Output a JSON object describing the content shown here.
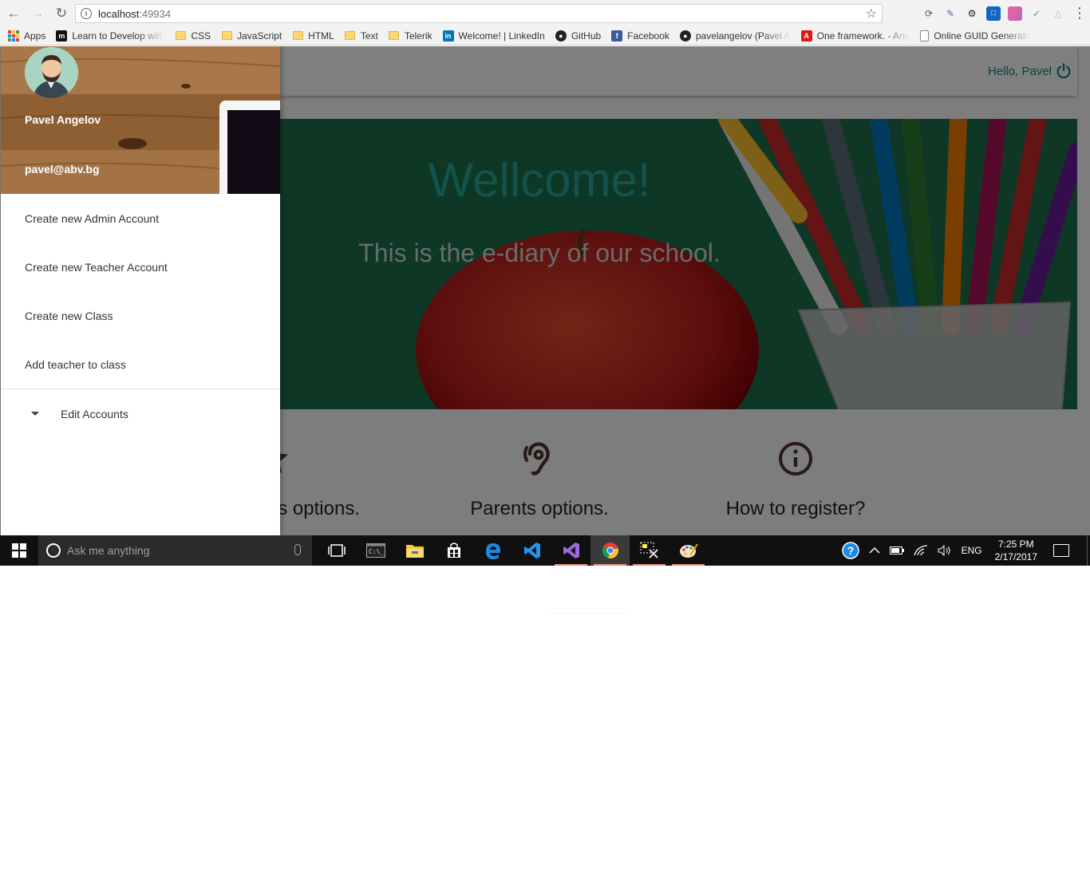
{
  "browser": {
    "url_host": "localhost",
    "url_port": ":49934"
  },
  "bookmarks": [
    {
      "label": "Apps",
      "icon": "apps-grid-icon"
    },
    {
      "label": "Learn to Develop with",
      "icon": "m-logo-icon"
    },
    {
      "label": "CSS",
      "icon": "folder-icon"
    },
    {
      "label": "JavaScript",
      "icon": "folder-icon"
    },
    {
      "label": "HTML",
      "icon": "folder-icon"
    },
    {
      "label": "Text",
      "icon": "folder-icon"
    },
    {
      "label": "Telerik",
      "icon": "folder-icon"
    },
    {
      "label": "Welcome! | LinkedIn",
      "icon": "linkedin-icon"
    },
    {
      "label": "GitHub",
      "icon": "github-icon"
    },
    {
      "label": "Facebook",
      "icon": "facebook-icon"
    },
    {
      "label": "pavelangelov (Pavel A",
      "icon": "github-icon"
    },
    {
      "label": "One framework. - Ang",
      "icon": "angular-icon"
    },
    {
      "label": "Online GUID Generato",
      "icon": "page-icon"
    }
  ],
  "header": {
    "greeting": "Hello, Pavel"
  },
  "hero": {
    "title": "Wellcome!",
    "subtitle": "This is the e-diary of our school."
  },
  "options": {
    "students": "s options.",
    "parents": "Parents options.",
    "register": "How to register?"
  },
  "sidenav": {
    "user_name": "Pavel Angelov",
    "user_email": "pavel@abv.bg",
    "items": [
      {
        "label": "Create new Admin Account"
      },
      {
        "label": "Create new Teacher Account"
      },
      {
        "label": "Create new Class"
      },
      {
        "label": "Add teacher to class"
      }
    ],
    "collapsible": {
      "label": "Edit Accounts"
    }
  },
  "taskbar": {
    "search_placeholder": "Ask me anything",
    "language": "ENG",
    "time": "7:25 PM",
    "date": "2/17/2017"
  },
  "colors": {
    "accent": "#00897b",
    "hero_title": "#26a69a",
    "taskbar": "#101010"
  }
}
